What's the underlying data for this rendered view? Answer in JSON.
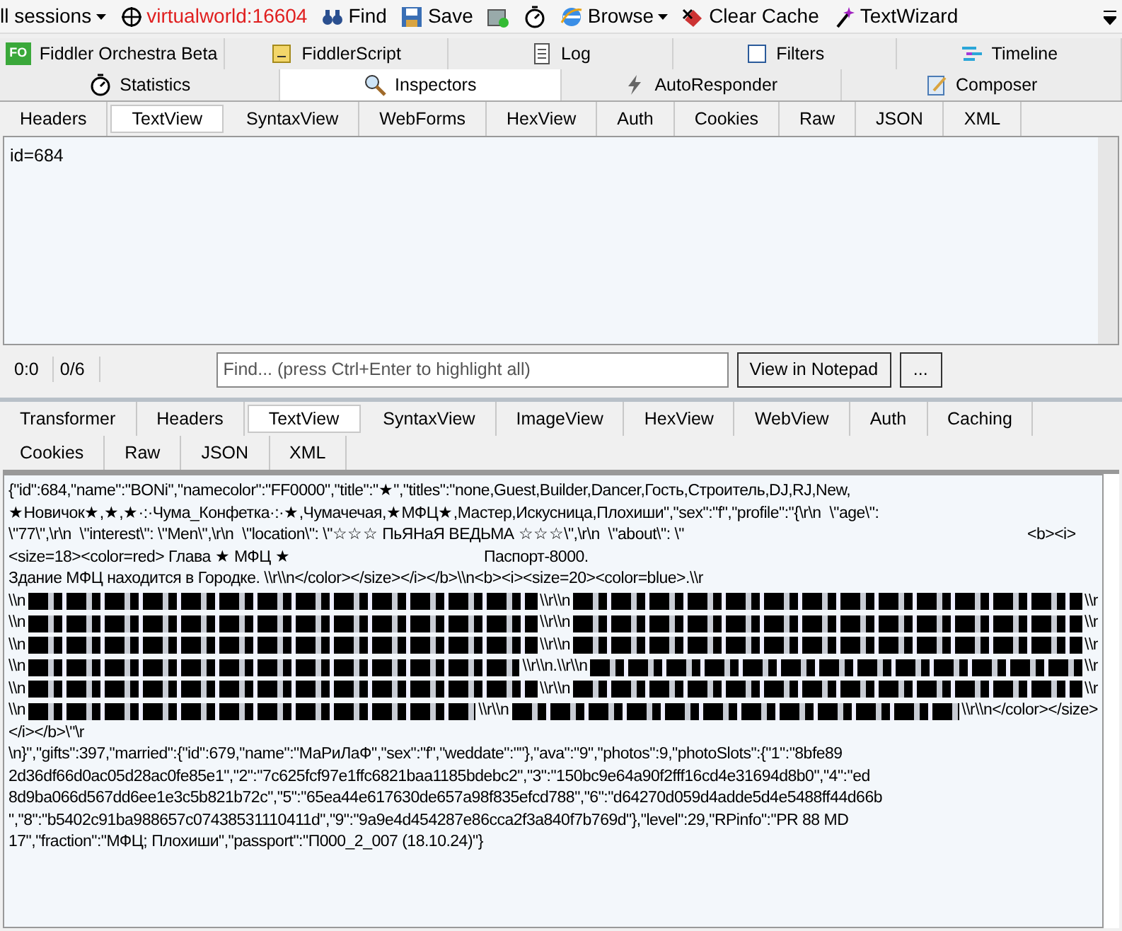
{
  "toolbar": [
    {
      "kind": "dropdown",
      "label": "ll sessions"
    },
    {
      "kind": "target",
      "label": "virtualworld:16604"
    },
    {
      "kind": "find",
      "label": "Find"
    },
    {
      "kind": "save",
      "label": "Save"
    },
    {
      "kind": "screenshot"
    },
    {
      "kind": "timer"
    },
    {
      "kind": "browse",
      "label": "Browse"
    },
    {
      "kind": "clear",
      "label": "Clear Cache"
    },
    {
      "kind": "wizard",
      "label": "TextWizard"
    }
  ],
  "main_tabs": [
    [
      {
        "label": "Fiddler Orchestra Beta",
        "kind": "fo",
        "logo_text": "FO",
        "selected": false
      },
      {
        "label": "FiddlerScript",
        "kind": "script",
        "selected": false
      },
      {
        "label": "Log",
        "kind": "log",
        "selected": false
      },
      {
        "label": "Filters",
        "kind": "filters",
        "selected": false
      },
      {
        "label": "Timeline",
        "kind": "timeline",
        "selected": false
      }
    ],
    [
      {
        "label": "Statistics",
        "kind": "timer",
        "selected": false
      },
      {
        "label": "Inspectors",
        "kind": "inspect",
        "selected": true
      },
      {
        "label": "AutoResponder",
        "kind": "bolt",
        "selected": false
      },
      {
        "label": "Composer",
        "kind": "compose",
        "selected": false
      }
    ]
  ],
  "request": {
    "tabs": [
      [
        {
          "label": "Headers",
          "selected": false
        },
        {
          "label": "TextView",
          "selected": true
        },
        {
          "label": "SyntaxView",
          "selected": false
        },
        {
          "label": "WebForms",
          "selected": false
        },
        {
          "label": "HexView",
          "selected": false
        },
        {
          "label": "Auth",
          "selected": false
        },
        {
          "label": "Cookies",
          "selected": false
        },
        {
          "label": "Raw",
          "selected": false
        },
        {
          "label": "JSON",
          "selected": false
        },
        {
          "label": "XML",
          "selected": false
        }
      ]
    ],
    "body": "id=684",
    "status": {
      "position": "0:0",
      "count": "0/6",
      "find_placeholder": "Find... (press Ctrl+Enter to highlight all)",
      "notepad_button": "View in Notepad",
      "more_button": "..."
    }
  },
  "response": {
    "tabs": [
      [
        {
          "label": "Transformer",
          "selected": false
        },
        {
          "label": "Headers",
          "selected": false
        },
        {
          "label": "TextView",
          "selected": true
        },
        {
          "label": "SyntaxView",
          "selected": false
        },
        {
          "label": "ImageView",
          "selected": false
        },
        {
          "label": "HexView",
          "selected": false
        },
        {
          "label": "WebView",
          "selected": false
        },
        {
          "label": "Auth",
          "selected": false
        },
        {
          "label": "Caching",
          "selected": false
        }
      ],
      [
        {
          "label": "Cookies",
          "selected": false
        },
        {
          "label": "Raw",
          "selected": false
        },
        {
          "label": "JSON",
          "selected": false
        },
        {
          "label": "XML",
          "selected": false
        }
      ]
    ],
    "lines": [
      [
        {
          "kind": "text",
          "text": "{\"id\":684,\"name\":\"BONi\",\"namecolor\":\"FF0000\",\"title\":\"★\",\"titles\":\"none,Guest,Builder,Dancer,Гость,Строитель,DJ,RJ,New,"
        }
      ],
      [
        {
          "kind": "text",
          "text": "★Новичок★,★,★·:·Чума_Конфетка·:·★,Чумачечая,★МФЦ★,Мастер,Искусница,Плохиши\",\"sex\":\"f\",\"profile\":\"{\\r\\n  \\\"age\\\":"
        }
      ],
      [
        {
          "kind": "text",
          "text": "\\\"77\\\",\\r\\n  \\\"interest\\\": \\\"Men\\\",\\r\\n  \\\"location\\\": \\\"☆☆☆ ПьЯНаЯ ВЕДЬМА ☆☆☆\\\",\\r\\n  \\\"about\\\": \\\"\t\t\t\t\t\t<b><i>"
        }
      ],
      [
        {
          "kind": "text",
          "text": "<size=18><color=red> Глава ★ МФЦ ★\t\t\tПаспорт-8000."
        }
      ],
      [
        {
          "kind": "text",
          "text": "Здание МФЦ находится в Городке. \\\\r\\\\n</color></size></i></b>\\\\n<b><i><size=20><color=blue>.\\\\r"
        }
      ],
      [
        {
          "kind": "text",
          "text": "\\\\n"
        },
        {
          "kind": "redacted"
        },
        {
          "kind": "text",
          "text": "\\\\r\\\\n"
        },
        {
          "kind": "redacted"
        },
        {
          "kind": "text",
          "text": "\\\\r"
        }
      ],
      [
        {
          "kind": "text",
          "text": "\\\\n"
        },
        {
          "kind": "redacted"
        },
        {
          "kind": "text",
          "text": "\\\\r\\\\n"
        },
        {
          "kind": "redacted"
        },
        {
          "kind": "text",
          "text": "\\\\r"
        }
      ],
      [
        {
          "kind": "text",
          "text": "\\\\n"
        },
        {
          "kind": "redacted"
        },
        {
          "kind": "text",
          "text": "\\\\r\\\\n"
        },
        {
          "kind": "redacted"
        },
        {
          "kind": "text",
          "text": "\\\\r"
        }
      ],
      [
        {
          "kind": "text",
          "text": "\\\\n"
        },
        {
          "kind": "redacted"
        },
        {
          "kind": "text",
          "text": "\\\\r\\\\n.\\\\r\\\\n"
        },
        {
          "kind": "redacted"
        },
        {
          "kind": "text",
          "text": "\\\\r"
        }
      ],
      [
        {
          "kind": "text",
          "text": "\\\\n"
        },
        {
          "kind": "redacted"
        },
        {
          "kind": "text",
          "text": "\\\\r\\\\n"
        },
        {
          "kind": "redacted"
        },
        {
          "kind": "text",
          "text": "\\\\r"
        }
      ],
      [
        {
          "kind": "text",
          "text": "\\\\n"
        },
        {
          "kind": "redacted"
        },
        {
          "kind": "text",
          "text": "\\\\r\\\\n"
        },
        {
          "kind": "redacted"
        },
        {
          "kind": "text",
          "text": "\\\\r\\\\n</color></size>"
        }
      ],
      [
        {
          "kind": "text",
          "text": "</i></b>\\\"\\r"
        }
      ],
      [
        {
          "kind": "text",
          "text": "\\n}\",\"gifts\":397,\"married\":{\"id\":679,\"name\":\"МаРиЛаФ\",\"sex\":\"f\",\"weddate\":\"\"},\"ava\":\"9\",\"photos\":9,\"photoSlots\":{\"1\":\"8bfe89"
        }
      ],
      [
        {
          "kind": "text",
          "text": "2d36df66d0ac05d28ac0fe85e1\",\"2\":\"7c625fcf97e1ffc6821baa1185bdebc2\",\"3\":\"150bc9e64a90f2fff16cd4e31694d8b0\",\"4\":\"ed"
        }
      ],
      [
        {
          "kind": "text",
          "text": "8d9ba066d567dd6ee1e3c5b821b72c\",\"5\":\"65ea44e617630de657a98f835efcd788\",\"6\":\"d64270d059d4adde5d4e5488ff44d66b"
        }
      ],
      [
        {
          "kind": "text",
          "text": "\",\"8\":\"b5402c91ba988657c07438531110411d\",\"9\":\"9a9e4d454287e86cca2f3a840f7b769d\"},\"level\":29,\"RPinfo\":\"PR 88 MD"
        }
      ],
      [
        {
          "kind": "text",
          "text": "17\",\"fraction\":\"МФЦ; Плохиши\",\"passport\":\"П000_2_007 (18.10.24)\"}"
        }
      ]
    ]
  }
}
